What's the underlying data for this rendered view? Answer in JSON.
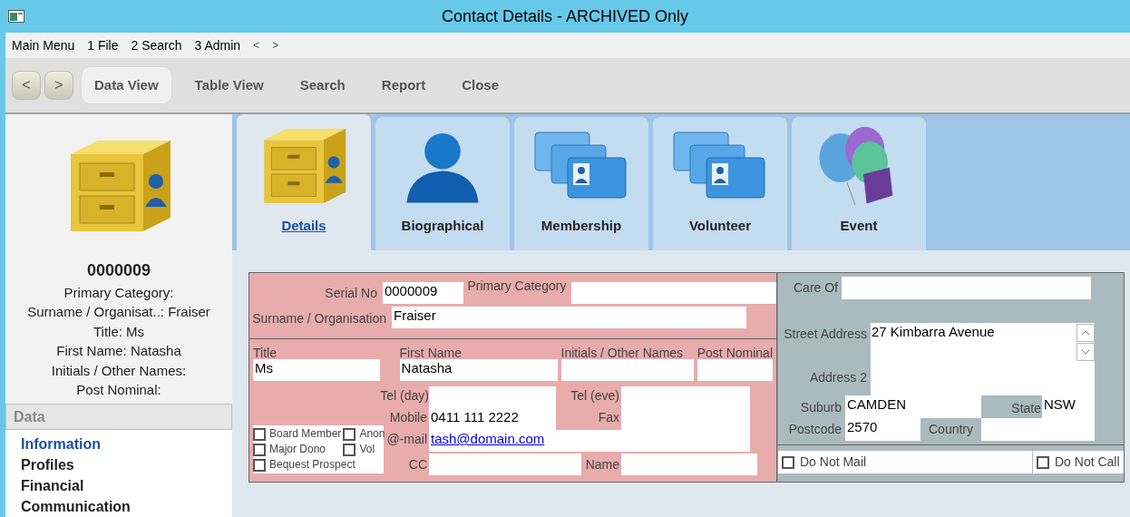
{
  "window": {
    "title": "Contact Details - ARCHIVED Only"
  },
  "menu_bar": [
    "Main Menu",
    "1 File",
    "2 Search",
    "3 Admin",
    "<",
    ">"
  ],
  "toolbar": {
    "nav_buttons": [
      "<",
      ">"
    ],
    "buttons": [
      {
        "label": "Data View",
        "selected": true
      },
      {
        "label": "Table View",
        "selected": false
      },
      {
        "label": "Search",
        "selected": false
      },
      {
        "label": "Report",
        "selected": false
      },
      {
        "label": "Close",
        "selected": false
      }
    ]
  },
  "sidebar": {
    "record_number": "0000009",
    "summary": [
      "Primary Category:",
      "Surname / Organisat..: Fraiser",
      "Title: Ms",
      "First Name: Natasha",
      "Initials / Other Names:",
      "Post Nominal:"
    ],
    "section": "Data",
    "items": [
      {
        "label": "Information",
        "selected": true
      },
      {
        "label": "Profiles",
        "selected": false
      },
      {
        "label": "Financial",
        "selected": false
      },
      {
        "label": "Communication",
        "selected": false
      }
    ]
  },
  "tabs": [
    {
      "label": "Details",
      "kind": "cabinet",
      "selected": true
    },
    {
      "label": "Biographical",
      "kind": "person",
      "selected": false
    },
    {
      "label": "Membership",
      "kind": "cards",
      "selected": false
    },
    {
      "label": "Volunteer",
      "kind": "cards",
      "selected": false
    },
    {
      "label": "Event",
      "kind": "balloons",
      "selected": false
    }
  ],
  "form": {
    "serial_no": {
      "label": "Serial No",
      "value": "0000009"
    },
    "primary_category": {
      "label": "Primary Category"
    },
    "surname": {
      "label": "Surname / Organisation",
      "value": "Fraiser"
    },
    "title": {
      "label": "Title",
      "value": "Ms"
    },
    "first_name": {
      "label": "First Name",
      "value": "Natasha"
    },
    "initials": {
      "label": "Initials / Other Names"
    },
    "post_nominal": {
      "label": "Post Nominal"
    },
    "tel_day": {
      "label": "Tel (day)"
    },
    "tel_eve": {
      "label": "Tel (eve)"
    },
    "mobile": {
      "label": "Mobile",
      "value": "0411 111 2222"
    },
    "fax": {
      "label": "Fax"
    },
    "email": {
      "label": "@-mail",
      "value": "tash@domain.com"
    },
    "cc": {
      "label": "CC"
    },
    "name": {
      "label": "Name"
    },
    "flags": [
      {
        "label": "Board Member",
        "checked": false
      },
      {
        "label": "Anon",
        "checked": false
      },
      {
        "label": "Major Dono",
        "checked": false
      },
      {
        "label": "Vol",
        "checked": false
      },
      {
        "label": "Bequest Prospect",
        "checked": false
      }
    ],
    "care_of": {
      "label": "Care Of"
    },
    "street_address": {
      "label": "Street Address",
      "value": "27 Kimbarra Avenue"
    },
    "address_2": {
      "label": "Address 2"
    },
    "suburb": {
      "label": "Suburb",
      "value": "CAMDEN"
    },
    "state": {
      "label": "State",
      "value": "NSW"
    },
    "postcode": {
      "label": "Postcode",
      "value": "2570"
    },
    "country": {
      "label": "Country"
    },
    "do_not_mail": {
      "label": "Do Not Mail",
      "checked": false
    },
    "do_not_call": {
      "label": "Do Not Call",
      "checked": false
    }
  }
}
